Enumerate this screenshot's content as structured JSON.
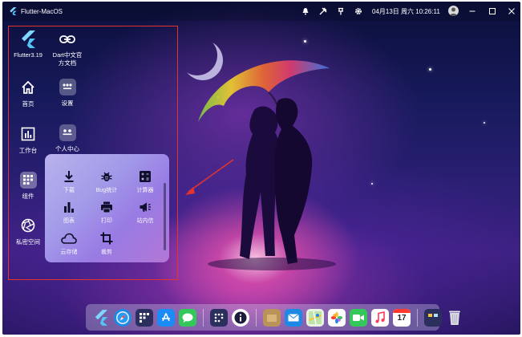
{
  "titlebar": {
    "app_title": "Flutter-MacOS",
    "clock": "04月13日 周六 10:26:11",
    "icons": [
      "bell-icon",
      "tools-icon",
      "pin-icon",
      "gear-icon"
    ]
  },
  "sidebar": {
    "items": [
      {
        "label": "Flutter3.19",
        "icon": "flutter-logo-icon"
      },
      {
        "label": "Dart中文官方文档",
        "icon": "link-icon"
      },
      {
        "label": "首页",
        "icon": "home-icon"
      },
      {
        "label": "设置",
        "icon": "settings-tile-icon"
      },
      {
        "label": "工作台",
        "icon": "chart-box-icon"
      },
      {
        "label": "个人中心",
        "icon": "profile-tile-icon"
      },
      {
        "label": "组件",
        "icon": "widgets-tile-icon"
      },
      {
        "label": "私密空间",
        "icon": "aperture-icon"
      }
    ]
  },
  "popup": {
    "items": [
      {
        "label": "下载",
        "icon": "download-icon"
      },
      {
        "label": "Bug统计",
        "icon": "bug-icon"
      },
      {
        "label": "计算器",
        "icon": "calculator-icon"
      },
      {
        "label": "图表",
        "icon": "bar-chart-icon"
      },
      {
        "label": "打印",
        "icon": "printer-icon"
      },
      {
        "label": "站内信",
        "icon": "megaphone-icon"
      },
      {
        "label": "云存储",
        "icon": "cloud-icon"
      },
      {
        "label": "裁剪",
        "icon": "crop-icon"
      }
    ]
  },
  "dock": {
    "calendar_day": "17",
    "icons": [
      "flutter-icon",
      "safari-icon",
      "widgets-icon",
      "app-store-icon",
      "messages-icon",
      "apps-grid-icon",
      "info-icon",
      "folder-icon",
      "mail-icon",
      "maps-icon",
      "photos-icon",
      "facetime-icon",
      "music-icon",
      "calendar-icon",
      "panels-icon",
      "trash-icon"
    ]
  },
  "colors": {
    "annotation_red": "#e2342c",
    "flutter_blue": "#54c5f8",
    "popup_start": "#bfb8f2",
    "popup_end": "#b67ad8"
  }
}
